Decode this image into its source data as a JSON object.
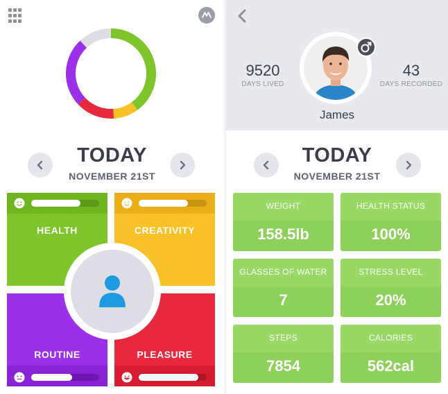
{
  "left": {
    "ring_segments": [
      {
        "name": "health",
        "color": "#7dc52a",
        "fraction": 0.4
      },
      {
        "name": "creativity",
        "color": "#f8c128",
        "fraction": 0.09
      },
      {
        "name": "pleasure",
        "color": "#e8283c",
        "fraction": 0.14
      },
      {
        "name": "routine",
        "color": "#9b30e8",
        "fraction": 0.25
      },
      {
        "name": "empty",
        "color": "#dcdde5",
        "fraction": 0.12
      }
    ],
    "date_nav": {
      "title": "TODAY",
      "date": "NOVEMBER 21ST"
    },
    "tiles": [
      {
        "key": "health",
        "label": "HEALTH",
        "color": "#7dc52a",
        "strip": "#6fb51f",
        "track": "#5a9a16",
        "level": 0.72
      },
      {
        "key": "creativity",
        "label": "CREATIVITY",
        "color": "#f8c128",
        "strip": "#eaaf18",
        "track": "#c99410",
        "level": 0.72
      },
      {
        "key": "routine",
        "label": "ROUTINE",
        "color": "#9b30e8",
        "strip": "#8a22d6",
        "track": "#6f16b0",
        "level": 0.6
      },
      {
        "key": "pleasure",
        "label": "PLEASURE",
        "color": "#e8283c",
        "strip": "#d61c30",
        "track": "#a81424",
        "level": 0.88
      }
    ]
  },
  "right": {
    "profile": {
      "days_lived": "9520",
      "days_lived_label": "DAYS LIVED",
      "days_recorded": "43",
      "days_recorded_label": "DAYS RECORDED",
      "name": "James"
    },
    "date_nav": {
      "title": "TODAY",
      "date": "NOVEMBER 21ST"
    },
    "metrics": [
      {
        "label": "WEIGHT",
        "value": "158.5lb"
      },
      {
        "label": "HEALTH STATUS",
        "value": "100%"
      },
      {
        "label": "GLASSES OF WATER",
        "value": "7"
      },
      {
        "label": "STRESS LEVEL",
        "value": "20%"
      },
      {
        "label": "STEPS",
        "value": "7854"
      },
      {
        "label": "CALORIES",
        "value": "562cal"
      }
    ]
  }
}
